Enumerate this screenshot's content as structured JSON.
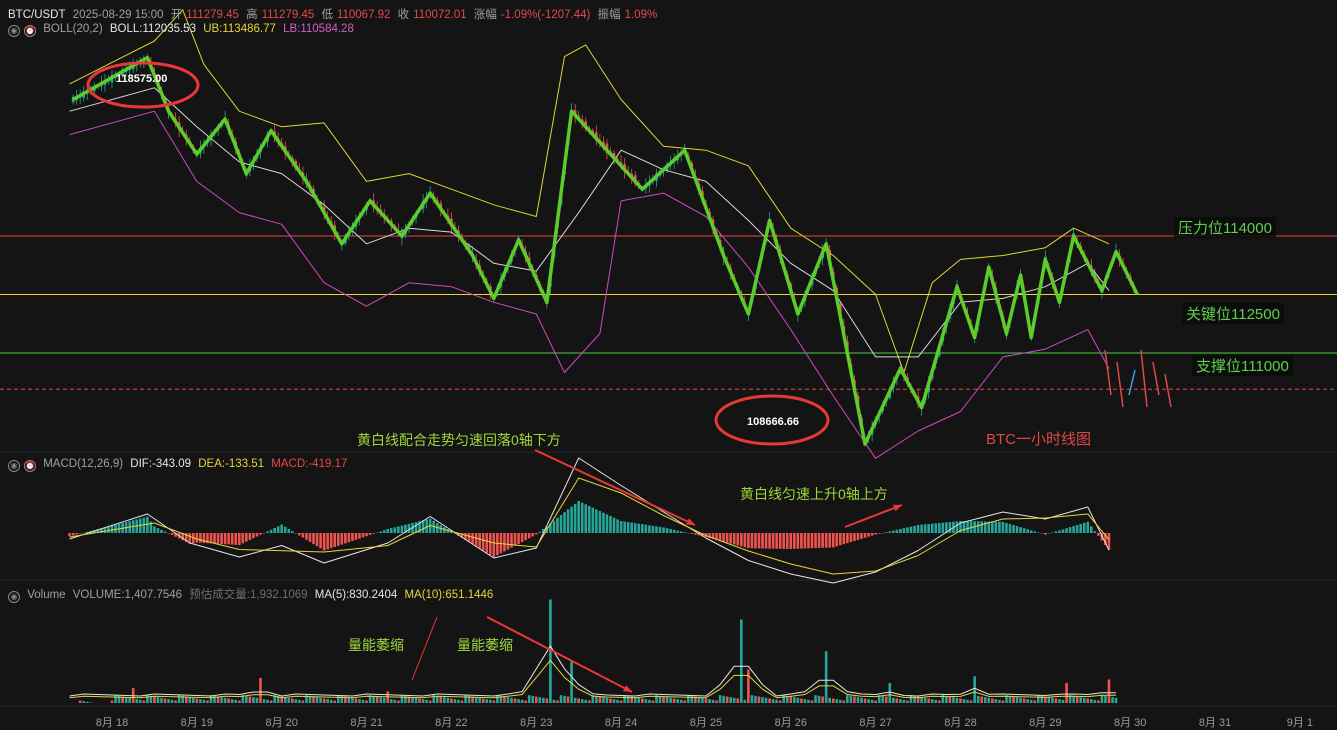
{
  "header": {
    "symbol": "BTC/USDT",
    "datetime": "2025-08-29 15:00",
    "open_label": "开",
    "open": "111279.45",
    "high_label": "高",
    "high": "111279.45",
    "low_label": "低",
    "low": "110067.92",
    "close_label": "收",
    "close": "110072.01",
    "change_label": "涨幅",
    "change": "-1.09%(-1207.44)",
    "amp_label": "振幅",
    "amp": "1.09%"
  },
  "boll": {
    "name": "BOLL(20,2)",
    "mid": "BOLL:112035.53",
    "ub": "UB:113486.77",
    "lb": "LB:110584.28"
  },
  "macd": {
    "name": "MACD(12,26,9)",
    "dif": "DIF:-343.09",
    "dea": "DEA:-133.51",
    "macd": "MACD:-419.17"
  },
  "volume": {
    "name": "Volume",
    "vol": "VOLUME:1,407.7546",
    "est": "预估成交量:1,932.1069",
    "ma5": "MA(5):830.2404",
    "ma10": "MA(10):651.1446"
  },
  "levels": {
    "resistance": "压力位114000",
    "key": "关键位112500",
    "support": "支撑位111000"
  },
  "markers": {
    "high_point": "118575.00",
    "low_point": "108666.66"
  },
  "annotations": {
    "chart_title": "BTC一小时线图",
    "macd_down": "黄白线配合走势匀速回落0轴下方",
    "macd_up": "黄白线匀速上升0轴上方",
    "vol_shrink_1": "量能萎缩",
    "vol_shrink_2": "量能萎缩"
  },
  "colors": {
    "up": "#26a69a",
    "down": "#ef5350",
    "trend": "#5ccc2a",
    "boll_upper": "#e0d534",
    "boll_mid": "#d8d8d8",
    "boll_lower": "#d048c4",
    "resistance_line": "#e04848",
    "key_line": "#e8d43a",
    "support_line": "#4ccf3a",
    "circle": "#e83838"
  },
  "chart_data": {
    "type": "line",
    "x_ticks": [
      "8月 18",
      "8月 19",
      "8月 20",
      "8月 21",
      "8月 22",
      "8月 23",
      "8月 24",
      "8月 25",
      "8月 26",
      "8月 27",
      "8月 28",
      "8月 29",
      "8月 30",
      "8月 31",
      "9月 1"
    ],
    "y_levels": {
      "resistance": 114000,
      "key": 112500,
      "support": 111000,
      "last_close": 110072.01
    },
    "trend_path": {
      "name": "trend",
      "points": [
        [
          "2025-08-17 13:00",
          117500
        ],
        [
          "2025-08-18 10:00",
          118575
        ],
        [
          "2025-08-18 16:00",
          117200
        ],
        [
          "2025-08-19 00:00",
          116100
        ],
        [
          "2025-08-19 08:00",
          117000
        ],
        [
          "2025-08-19 14:00",
          115600
        ],
        [
          "2025-08-19 21:00",
          116700
        ],
        [
          "2025-08-20 07:00",
          115400
        ],
        [
          "2025-08-20 17:00",
          113800
        ],
        [
          "2025-08-21 01:00",
          114900
        ],
        [
          "2025-08-21 10:00",
          114000
        ],
        [
          "2025-08-21 18:00",
          115100
        ],
        [
          "2025-08-22 06:00",
          113500
        ],
        [
          "2025-08-22 12:00",
          112400
        ],
        [
          "2025-08-22 19:00",
          113900
        ],
        [
          "2025-08-23 03:00",
          112300
        ],
        [
          "2025-08-23 10:00",
          117200
        ],
        [
          "2025-08-24 06:00",
          115200
        ],
        [
          "2025-08-24 18:00",
          116200
        ],
        [
          "2025-08-25 05:00",
          113500
        ],
        [
          "2025-08-25 12:00",
          112000
        ],
        [
          "2025-08-25 18:00",
          114400
        ],
        [
          "2025-08-26 02:00",
          112000
        ],
        [
          "2025-08-26 10:00",
          113800
        ],
        [
          "2025-08-26 21:00",
          108666.66
        ],
        [
          "2025-08-27 07:00",
          110600
        ],
        [
          "2025-08-27 13:00",
          109600
        ],
        [
          "2025-08-27 23:00",
          112700
        ],
        [
          "2025-08-28 04:00",
          111400
        ],
        [
          "2025-08-28 08:00",
          113200
        ],
        [
          "2025-08-28 13:00",
          111500
        ],
        [
          "2025-08-28 17:00",
          113000
        ],
        [
          "2025-08-28 20:00",
          111400
        ],
        [
          "2025-08-29 00:00",
          113400
        ],
        [
          "2025-08-29 04:00",
          112300
        ],
        [
          "2025-08-29 08:00",
          114000
        ],
        [
          "2025-08-29 16:00",
          112600
        ],
        [
          "2025-08-29 20:00",
          113600
        ],
        [
          "2025-08-30 02:00",
          112500
        ]
      ]
    },
    "boll_upper_series": {
      "name": "UB",
      "points": [
        [
          "2025-08-17 12:00",
          117900
        ],
        [
          "2025-08-18 12:00",
          119000
        ],
        [
          "2025-08-18 20:00",
          119800
        ],
        [
          "2025-08-19 02:00",
          118400
        ],
        [
          "2025-08-19 12:00",
          117200
        ],
        [
          "2025-08-20 00:00",
          116800
        ],
        [
          "2025-08-20 12:00",
          116900
        ],
        [
          "2025-08-21 00:00",
          115400
        ],
        [
          "2025-08-21 12:00",
          115600
        ],
        [
          "2025-08-22 00:00",
          115200
        ],
        [
          "2025-08-22 12:00",
          114800
        ],
        [
          "2025-08-23 00:00",
          114500
        ],
        [
          "2025-08-23 08:00",
          118600
        ],
        [
          "2025-08-23 14:00",
          118900
        ],
        [
          "2025-08-24 00:00",
          117500
        ],
        [
          "2025-08-24 12:00",
          116300
        ],
        [
          "2025-08-25 00:00",
          116200
        ],
        [
          "2025-08-25 12:00",
          115800
        ],
        [
          "2025-08-26 00:00",
          114200
        ],
        [
          "2025-08-26 12:00",
          113500
        ],
        [
          "2025-08-27 00:00",
          112500
        ],
        [
          "2025-08-27 08:00",
          110500
        ],
        [
          "2025-08-27 16:00",
          112800
        ],
        [
          "2025-08-28 00:00",
          113400
        ],
        [
          "2025-08-28 12:00",
          113500
        ],
        [
          "2025-08-29 00:00",
          113700
        ],
        [
          "2025-08-29 08:00",
          114200
        ],
        [
          "2025-08-29 18:00",
          113800
        ]
      ]
    },
    "boll_mid_series": {
      "name": "BOLL",
      "points": [
        [
          "2025-08-17 12:00",
          117200
        ],
        [
          "2025-08-18 12:00",
          117800
        ],
        [
          "2025-08-19 00:00",
          116800
        ],
        [
          "2025-08-19 12:00",
          115900
        ],
        [
          "2025-08-20 00:00",
          115600
        ],
        [
          "2025-08-20 12:00",
          114800
        ],
        [
          "2025-08-21 00:00",
          113800
        ],
        [
          "2025-08-21 12:00",
          114200
        ],
        [
          "2025-08-22 00:00",
          114100
        ],
        [
          "2025-08-22 12:00",
          113300
        ],
        [
          "2025-08-23 00:00",
          113100
        ],
        [
          "2025-08-23 12:00",
          114600
        ],
        [
          "2025-08-24 00:00",
          116200
        ],
        [
          "2025-08-24 12:00",
          115700
        ],
        [
          "2025-08-25 00:00",
          115400
        ],
        [
          "2025-08-25 12:00",
          114400
        ],
        [
          "2025-08-26 00:00",
          113300
        ],
        [
          "2025-08-26 12:00",
          112600
        ],
        [
          "2025-08-27 00:00",
          110900
        ],
        [
          "2025-08-27 12:00",
          110900
        ],
        [
          "2025-08-28 00:00",
          112300
        ],
        [
          "2025-08-28 12:00",
          112400
        ],
        [
          "2025-08-29 00:00",
          112700
        ],
        [
          "2025-08-29 12:00",
          113300
        ],
        [
          "2025-08-29 18:00",
          112600
        ]
      ]
    },
    "boll_lower_series": {
      "name": "LB",
      "points": [
        [
          "2025-08-17 12:00",
          116600
        ],
        [
          "2025-08-18 12:00",
          117200
        ],
        [
          "2025-08-19 00:00",
          115400
        ],
        [
          "2025-08-19 12:00",
          114600
        ],
        [
          "2025-08-20 00:00",
          114300
        ],
        [
          "2025-08-20 12:00",
          112800
        ],
        [
          "2025-08-21 00:00",
          112200
        ],
        [
          "2025-08-21 12:00",
          112800
        ],
        [
          "2025-08-22 00:00",
          112700
        ],
        [
          "2025-08-22 12:00",
          112300
        ],
        [
          "2025-08-23 00:00",
          112000
        ],
        [
          "2025-08-23 08:00",
          110500
        ],
        [
          "2025-08-23 18:00",
          111500
        ],
        [
          "2025-08-24 00:00",
          114900
        ],
        [
          "2025-08-24 12:00",
          115100
        ],
        [
          "2025-08-25 00:00",
          114500
        ],
        [
          "2025-08-25 12:00",
          113200
        ],
        [
          "2025-08-26 00:00",
          111600
        ],
        [
          "2025-08-26 12:00",
          109900
        ],
        [
          "2025-08-27 00:00",
          108300
        ],
        [
          "2025-08-27 12:00",
          109000
        ],
        [
          "2025-08-28 00:00",
          109500
        ],
        [
          "2025-08-28 12:00",
          110900
        ],
        [
          "2025-08-29 00:00",
          111100
        ],
        [
          "2025-08-29 12:00",
          111600
        ],
        [
          "2025-08-29 18:00",
          110600
        ]
      ]
    },
    "macd_panel": {
      "zero_line": 0,
      "dif": -343.09,
      "dea": -133.51,
      "macd": -419.17,
      "dif_points": [
        [
          "2025-08-17 12:00",
          -120
        ],
        [
          "2025-08-18 10:00",
          380
        ],
        [
          "2025-08-18 22:00",
          -200
        ],
        [
          "2025-08-19 12:00",
          -480
        ],
        [
          "2025-08-20 00:00",
          -250
        ],
        [
          "2025-08-20 12:00",
          -600
        ],
        [
          "2025-08-21 06:00",
          -200
        ],
        [
          "2025-08-21 18:00",
          330
        ],
        [
          "2025-08-22 12:00",
          -500
        ],
        [
          "2025-08-23 00:00",
          -300
        ],
        [
          "2025-08-23 12:00",
          1500
        ],
        [
          "2025-08-24 00:00",
          950
        ],
        [
          "2025-08-24 12:00",
          420
        ],
        [
          "2025-08-25 00:00",
          -100
        ],
        [
          "2025-08-25 12:00",
          -550
        ],
        [
          "2025-08-26 00:00",
          -820
        ],
        [
          "2025-08-26 12:00",
          -1000
        ],
        [
          "2025-08-27 00:00",
          -780
        ],
        [
          "2025-08-27 12:00",
          -350
        ],
        [
          "2025-08-28 00:00",
          200
        ],
        [
          "2025-08-28 12:00",
          420
        ],
        [
          "2025-08-29 00:00",
          280
        ],
        [
          "2025-08-29 12:00",
          520
        ],
        [
          "2025-08-29 18:00",
          -343.09
        ]
      ],
      "dea_points": [
        [
          "2025-08-17 12:00",
          -80
        ],
        [
          "2025-08-18 12:00",
          200
        ],
        [
          "2025-08-19 00:00",
          -120
        ],
        [
          "2025-08-19 12:00",
          -330
        ],
        [
          "2025-08-20 12:00",
          -380
        ],
        [
          "2025-08-21 06:00",
          -250
        ],
        [
          "2025-08-21 18:00",
          150
        ],
        [
          "2025-08-22 12:00",
          -200
        ],
        [
          "2025-08-23 00:00",
          -280
        ],
        [
          "2025-08-23 12:00",
          1100
        ],
        [
          "2025-08-24 00:00",
          800
        ],
        [
          "2025-08-24 12:00",
          350
        ],
        [
          "2025-08-25 00:00",
          -50
        ],
        [
          "2025-08-25 12:00",
          -360
        ],
        [
          "2025-08-26 00:00",
          -620
        ],
        [
          "2025-08-26 12:00",
          -820
        ],
        [
          "2025-08-27 00:00",
          -760
        ],
        [
          "2025-08-27 12:00",
          -450
        ],
        [
          "2025-08-28 00:00",
          50
        ],
        [
          "2025-08-28 12:00",
          280
        ],
        [
          "2025-08-29 00:00",
          300
        ],
        [
          "2025-08-29 12:00",
          380
        ],
        [
          "2025-08-29 18:00",
          -133.51
        ]
      ]
    },
    "volume_panel": {
      "volume": 1407.7546,
      "est_volume": 1932.1069,
      "ma5": 830.2404,
      "ma10": 651.1446,
      "spikes": [
        [
          "2025-08-18 06:00",
          900
        ],
        [
          "2025-08-19 18:00",
          1500
        ],
        [
          "2025-08-21 06:00",
          700
        ],
        [
          "2025-08-23 04:00",
          6200
        ],
        [
          "2025-08-23 10:00",
          2500
        ],
        [
          "2025-08-25 10:00",
          5000
        ],
        [
          "2025-08-25 12:00",
          2000
        ],
        [
          "2025-08-26 10:00",
          3100
        ],
        [
          "2025-08-27 04:00",
          1200
        ],
        [
          "2025-08-28 04:00",
          1600
        ],
        [
          "2025-08-29 06:00",
          1200
        ],
        [
          "2025-08-29 18:00",
          1407.7546
        ]
      ]
    },
    "projection": [
      "down",
      "down",
      "up",
      "down",
      "down",
      "down"
    ]
  }
}
